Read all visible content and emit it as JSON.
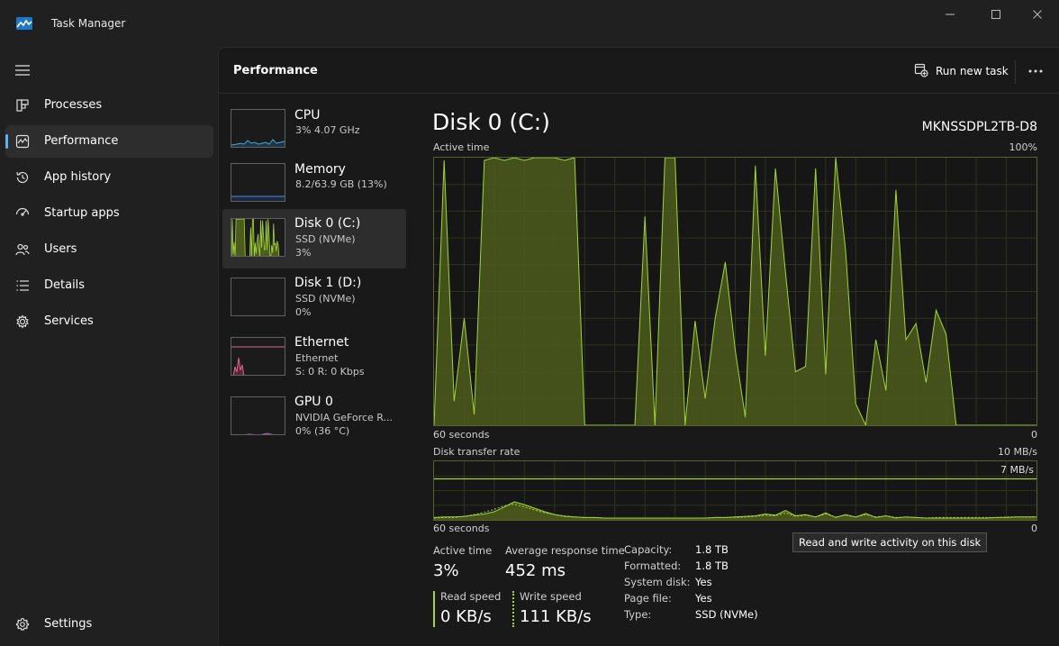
{
  "app": {
    "title": "Task Manager"
  },
  "nav": {
    "items": [
      {
        "label": "Processes",
        "icon": "processes-icon"
      },
      {
        "label": "Performance",
        "icon": "performance-icon",
        "active": true
      },
      {
        "label": "App history",
        "icon": "app-history-icon"
      },
      {
        "label": "Startup apps",
        "icon": "startup-apps-icon"
      },
      {
        "label": "Users",
        "icon": "users-icon"
      },
      {
        "label": "Details",
        "icon": "details-icon"
      },
      {
        "label": "Services",
        "icon": "services-icon"
      }
    ],
    "settings_label": "Settings"
  },
  "header": {
    "title": "Performance",
    "run_new_task": "Run new task"
  },
  "devices": [
    {
      "name": "CPU",
      "sub1": "3% 4.07 GHz",
      "sub2": ""
    },
    {
      "name": "Memory",
      "sub1": "8.2/63.9 GB (13%)",
      "sub2": ""
    },
    {
      "name": "Disk 0 (C:)",
      "sub1": "SSD (NVMe)",
      "sub2": "3%",
      "selected": true
    },
    {
      "name": "Disk 1 (D:)",
      "sub1": "SSD (NVMe)",
      "sub2": "0%"
    },
    {
      "name": "Ethernet",
      "sub1": "Ethernet",
      "sub2": "S: 0 R: 0 Kbps"
    },
    {
      "name": "GPU 0",
      "sub1": "NVIDIA GeForce R...",
      "sub2": "0%  (36 °C)"
    }
  ],
  "detail": {
    "title": "Disk 0 (C:)",
    "model": "MKNSSDPL2TB-D8",
    "active_time_label": "Active time",
    "active_time_max": "100%",
    "graph_span_label": "60 seconds",
    "graph_zero": "0",
    "transfer_label": "Disk transfer rate",
    "transfer_max": "10 MB/s",
    "transfer_line_label": "7 MB/s"
  },
  "stats": {
    "active_time": {
      "label": "Active time",
      "value": "3%"
    },
    "avg_response": {
      "label": "Average response time",
      "value": "452 ms"
    },
    "read_speed": {
      "label": "Read speed",
      "value": "0 KB/s"
    },
    "write_speed": {
      "label": "Write speed",
      "value": "111 KB/s"
    }
  },
  "properties": [
    {
      "label": "Capacity:",
      "value": "1.8 TB"
    },
    {
      "label": "Formatted:",
      "value": "1.8 TB"
    },
    {
      "label": "System disk:",
      "value": "Yes"
    },
    {
      "label": "Page file:",
      "value": "Yes"
    },
    {
      "label": "Type:",
      "value": "SSD (NVMe)"
    }
  ],
  "tooltip": "Read and write activity on this disk",
  "colors": {
    "accent": "#5fb2f2",
    "disk_line": "#a3d43a",
    "disk_fill": "#4c5c1c",
    "graph_border": "#57612a",
    "grid": "#2e3320",
    "cpu_line": "#48a6d6",
    "memory_line": "#4a8ed8",
    "ethernet_line": "#d9688f",
    "gpu_line": "#b366c9"
  },
  "chart_data": [
    {
      "type": "area",
      "title": "Active time",
      "xlabel": "60 seconds",
      "ylabel": "",
      "ylim": [
        0,
        100
      ],
      "x": [
        0,
        1,
        2,
        3,
        4,
        5,
        6,
        7,
        8,
        9,
        10,
        11,
        12,
        13,
        14,
        15,
        16,
        17,
        18,
        19,
        20,
        21,
        22,
        23,
        24,
        25,
        26,
        27,
        28,
        29,
        30,
        31,
        32,
        33,
        34,
        35,
        36,
        37,
        38,
        39,
        40,
        41,
        42,
        43,
        44,
        45,
        46,
        47,
        48,
        49,
        50,
        51,
        52,
        53,
        54,
        55,
        56,
        57,
        58,
        59,
        60
      ],
      "series": [
        {
          "values": [
            0,
            99,
            9,
            40,
            4,
            99,
            100,
            99,
            100,
            99,
            100,
            100,
            100,
            99,
            100,
            0,
            0,
            0,
            0,
            0,
            0,
            78,
            0,
            100,
            100,
            0,
            39,
            10,
            40,
            61,
            28,
            3,
            97,
            26,
            96,
            57,
            20,
            22,
            96,
            19,
            100,
            65,
            8,
            0,
            32,
            13,
            88,
            32,
            38,
            16,
            43,
            34,
            0,
            0,
            0,
            0,
            0,
            0,
            0,
            0,
            0
          ]
        }
      ]
    },
    {
      "type": "line",
      "title": "Disk transfer rate",
      "xlabel": "60 seconds",
      "ylim": [
        0,
        10
      ],
      "series": [
        {
          "values": [
            0.4,
            0.5,
            0.5,
            0.6,
            0.8,
            1.0,
            1.4,
            2.2,
            3.1,
            2.6,
            2.0,
            1.4,
            0.9,
            0.6,
            0.5,
            0.4,
            0.4,
            0.3,
            0.3,
            0.3,
            0.3,
            0.3,
            0.3,
            0.3,
            0.3,
            0.3,
            0.3,
            0.3,
            0.4,
            0.4,
            0.5,
            0.6,
            0.7,
            1.0,
            0.8,
            1.6,
            0.7,
            0.9,
            0.5,
            1.2,
            0.4,
            0.9,
            0.5,
            1.1,
            0.4,
            0.7,
            0.3,
            0.5,
            0.4,
            0.3,
            0.3,
            0.3,
            0.3,
            0.3,
            0.3,
            0.3,
            0.4,
            0.4,
            0.5,
            0.5,
            0.5
          ]
        },
        {
          "values": [
            0.3,
            0.4,
            0.4,
            0.6,
            0.9,
            1.3,
            1.8,
            2.4,
            2.7,
            2.2,
            1.7,
            1.2,
            0.9,
            0.7,
            0.5,
            0.4,
            0.4,
            0.3,
            0.3,
            0.3,
            0.3,
            0.3,
            0.3,
            0.3,
            0.3,
            0.3,
            0.3,
            0.3,
            0.4,
            0.4,
            0.4,
            0.5,
            0.6,
            0.8,
            0.7,
            1.2,
            0.6,
            0.8,
            0.5,
            1.0,
            0.5,
            0.8,
            0.5,
            0.9,
            0.5,
            0.7,
            0.4,
            0.5,
            0.4,
            0.3,
            0.4,
            0.4,
            0.4,
            0.4,
            0.4,
            0.4,
            0.4,
            0.5,
            0.5,
            0.5,
            0.5
          ]
        }
      ],
      "reference_line": 7
    }
  ]
}
